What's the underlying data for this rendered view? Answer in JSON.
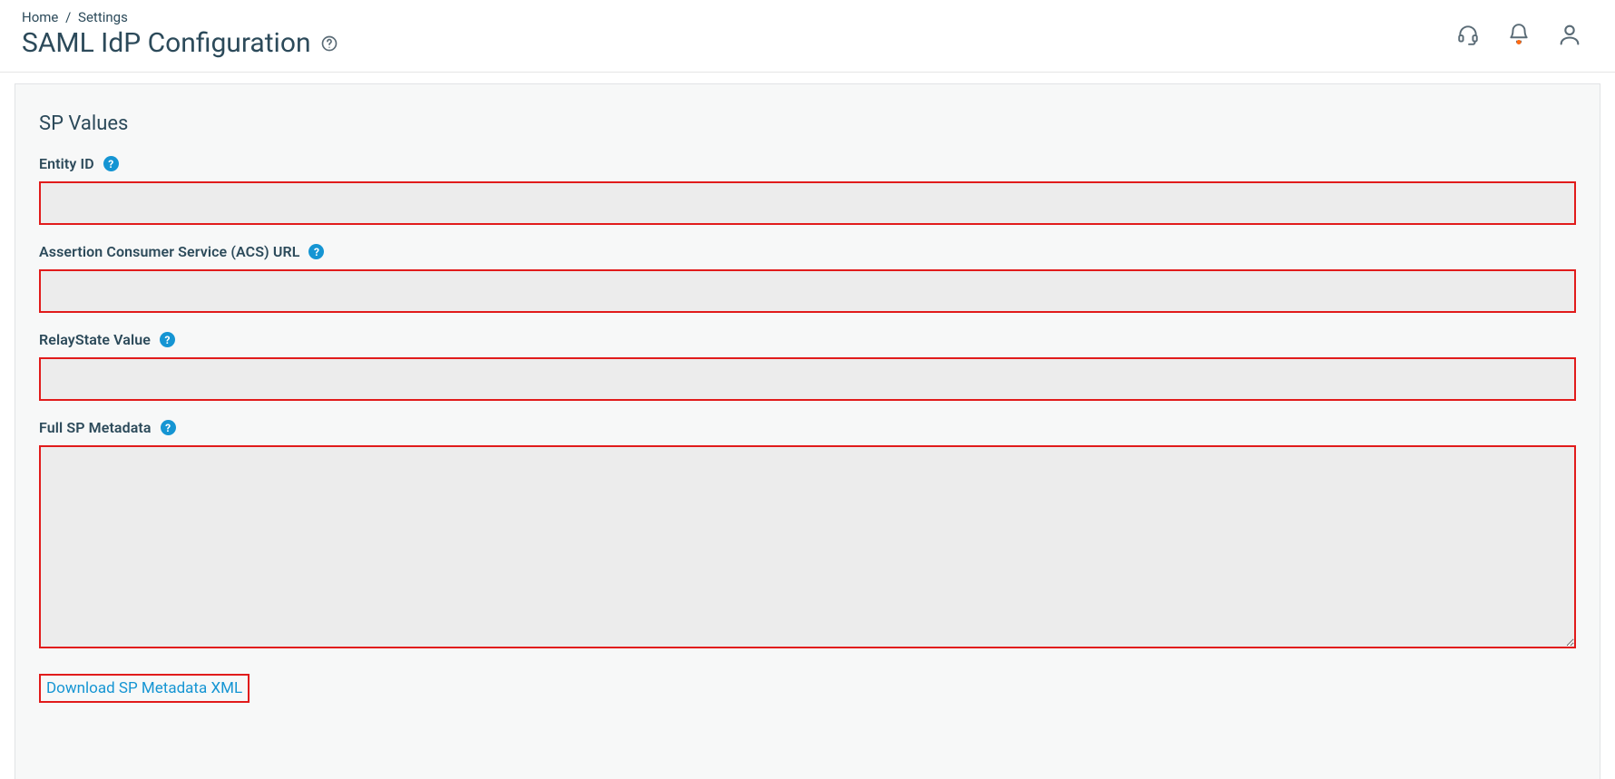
{
  "breadcrumb": {
    "home": "Home",
    "settings": "Settings"
  },
  "page": {
    "title": "SAML IdP Configuration"
  },
  "section": {
    "title": "SP Values"
  },
  "fields": {
    "entity_id": {
      "label": "Entity ID",
      "value": ""
    },
    "acs_url": {
      "label": "Assertion Consumer Service (ACS) URL",
      "value": ""
    },
    "relay_state": {
      "label": "RelayState Value",
      "value": ""
    },
    "full_sp_metadata": {
      "label": "Full SP Metadata",
      "value": ""
    }
  },
  "actions": {
    "download_metadata": "Download SP Metadata XML"
  },
  "help_glyph": "?"
}
